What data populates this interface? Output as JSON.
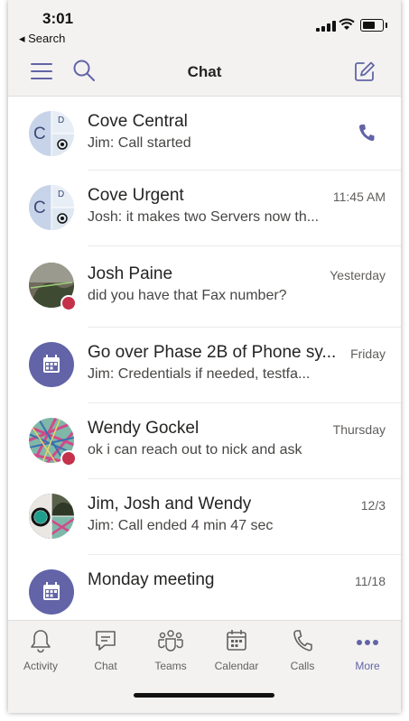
{
  "status": {
    "time": "3:01",
    "back_label": "Search"
  },
  "header": {
    "title": "Chat"
  },
  "chats": [
    {
      "name": "Cove Central",
      "preview": "Jim: Call started",
      "time": "",
      "avatar": "cove-group-avatar",
      "initial_main": "C",
      "initial_side": "D",
      "presence": "",
      "trailing_icon": "phone-icon"
    },
    {
      "name": "Cove Urgent",
      "preview": "Josh: it makes two Servers now th...",
      "time": "11:45 AM",
      "avatar": "cove-group-avatar",
      "initial_main": "C",
      "initial_side": "D",
      "presence": "",
      "trailing_icon": ""
    },
    {
      "name": "Josh Paine",
      "preview": "did you have that Fax number?",
      "time": "Yesterday",
      "avatar": "photo-avatar",
      "presence": "busy"
    },
    {
      "name": "Go over Phase 2B of Phone sy...",
      "preview": "Jim: Credentials if needed,  testfa...",
      "time": "Friday",
      "avatar": "calendar-avatar",
      "presence": ""
    },
    {
      "name": "Wendy Gockel",
      "preview": "ok i can reach out to nick and ask",
      "time": "Thursday",
      "avatar": "photo-avatar",
      "presence": "busy"
    },
    {
      "name": "Jim, Josh and Wendy",
      "preview": "Jim: Call ended 4 min 47 sec",
      "time": "12/3",
      "avatar": "group-photo-avatar",
      "presence": ""
    },
    {
      "name": "Monday meeting",
      "preview": "",
      "time": "11/18",
      "avatar": "calendar-avatar",
      "presence": ""
    }
  ],
  "tabs": [
    {
      "label": "Activity",
      "icon": "bell-icon",
      "active": false
    },
    {
      "label": "Chat",
      "icon": "chat-icon",
      "active": false
    },
    {
      "label": "Teams",
      "icon": "teams-icon",
      "active": false
    },
    {
      "label": "Calendar",
      "icon": "calendar-icon",
      "active": false
    },
    {
      "label": "Calls",
      "icon": "phone-icon",
      "active": false
    },
    {
      "label": "More",
      "icon": "more-icon",
      "active": true
    }
  ],
  "colors": {
    "accent": "#6264a7",
    "busy": "#c4314b",
    "background": "#f3f2f1"
  }
}
